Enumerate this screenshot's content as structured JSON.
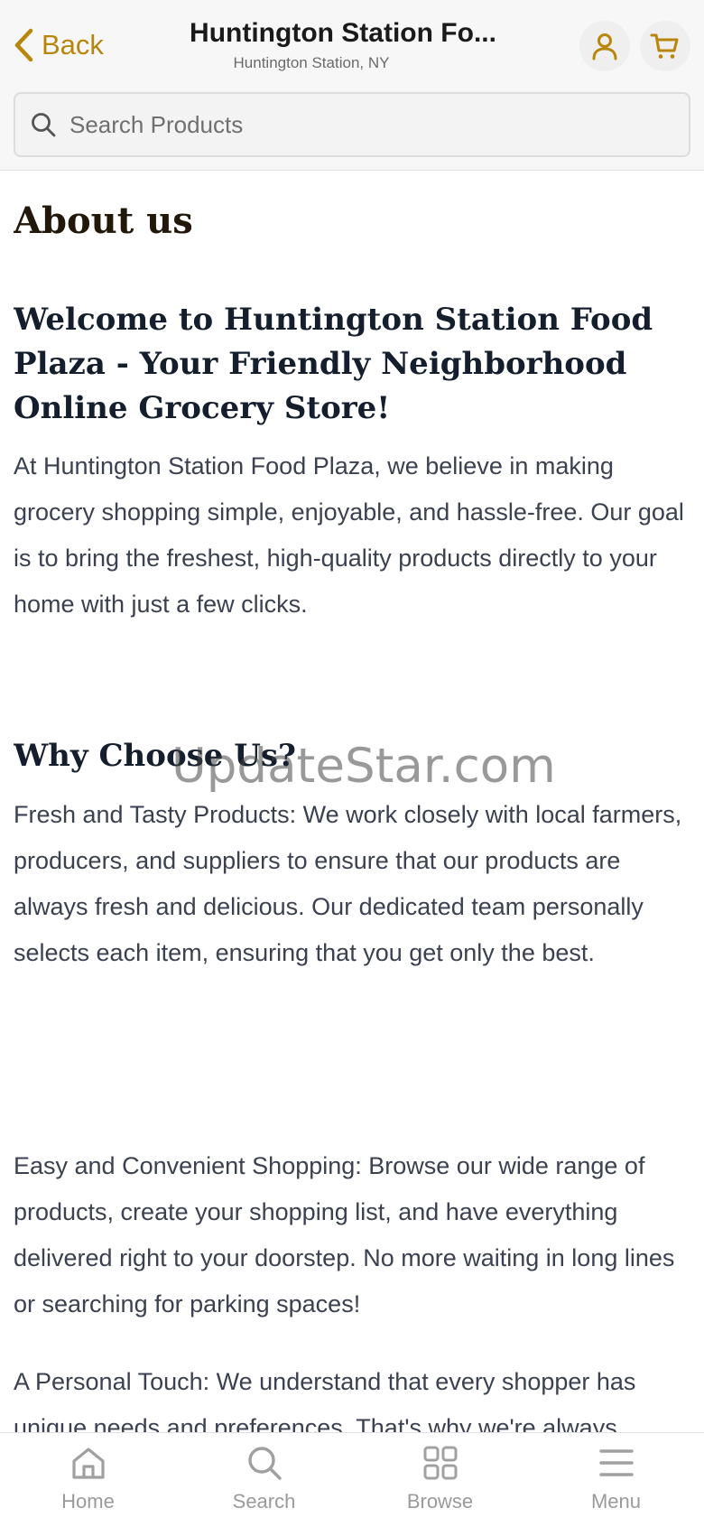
{
  "header": {
    "back_label": "Back",
    "store_name": "Huntington Station Fo...",
    "store_location": "Huntington Station, NY",
    "accent_color": "#b8860b"
  },
  "search": {
    "placeholder": "Search Products"
  },
  "about": {
    "title": "About us",
    "welcome_heading": "Welcome to Huntington Station Food Plaza - Your Friendly Neighborhood Online Grocery Store!",
    "intro": "At Huntington Station Food Plaza, we believe in making grocery shopping simple, enjoyable, and hassle-free. Our goal is to bring the freshest, high-quality products directly to your home with just a few clicks.",
    "why_heading": "Why Choose Us?",
    "fresh": "Fresh and Tasty Products: We work closely with local farmers, producers, and suppliers to ensure that our products are always fresh and delicious. Our dedicated team personally selects each item, ensuring that you get only the best.",
    "easy": "Easy and Convenient Shopping: Browse our wide range of products, create your shopping list, and have everything delivered right to your doorstep. No more waiting in long lines or searching for parking spaces!",
    "personal": "A Personal Touch: We understand that every shopper has unique needs and preferences. That's why we're always working to learn more about what you like, so we can make your shopping experience even better."
  },
  "watermark": "UpdateStar.com",
  "nav": {
    "items": [
      {
        "label": "Home",
        "icon": "home-icon"
      },
      {
        "label": "Search",
        "icon": "search-icon"
      },
      {
        "label": "Browse",
        "icon": "grid-icon"
      },
      {
        "label": "Menu",
        "icon": "menu-icon"
      }
    ]
  }
}
